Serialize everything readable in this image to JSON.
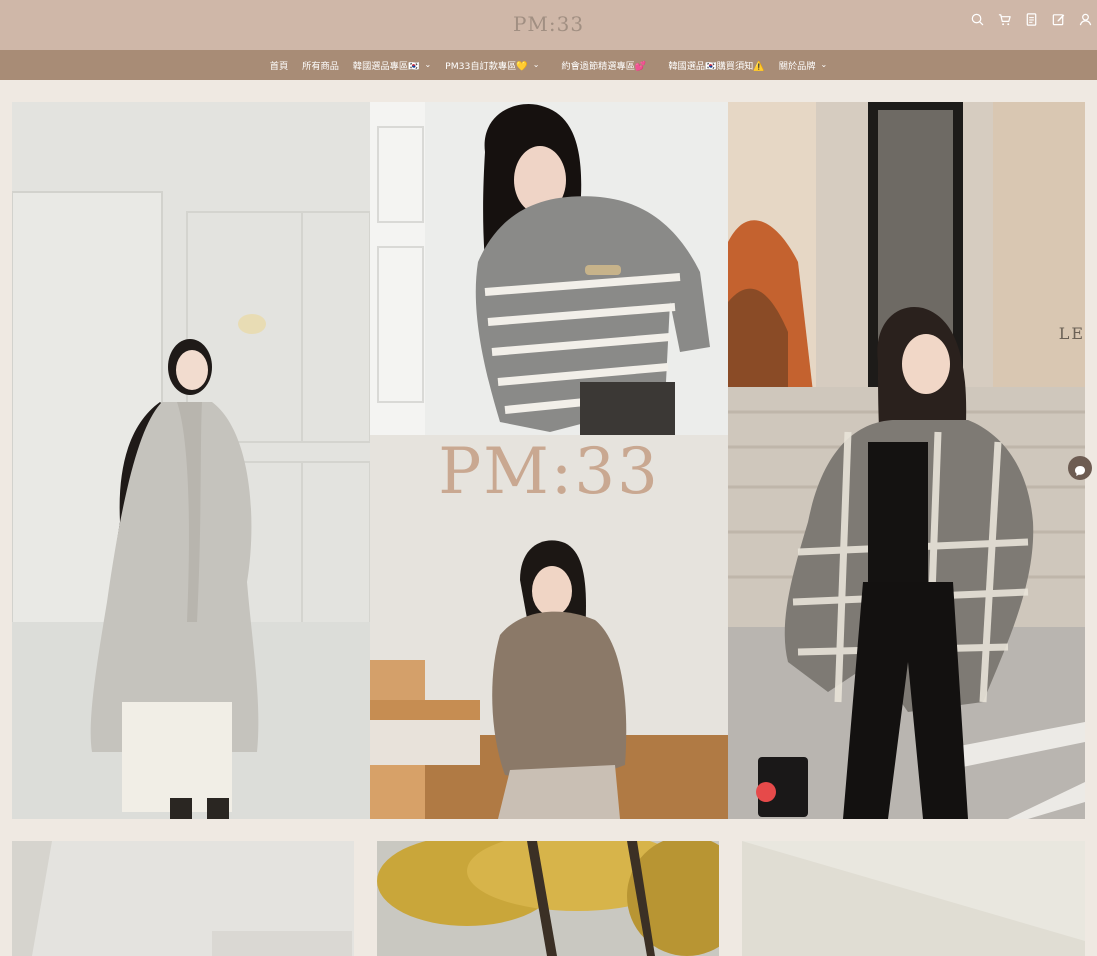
{
  "header": {
    "logo": "PM:33",
    "icons": [
      "search-icon",
      "cart-icon",
      "orders-icon",
      "edit-icon",
      "user-icon"
    ]
  },
  "nav": {
    "items": [
      {
        "label": "首頁",
        "has_dropdown": false
      },
      {
        "label": "所有商品",
        "has_dropdown": false
      },
      {
        "label": "韓國選品專區🇰🇷",
        "has_dropdown": true
      },
      {
        "label": "PM33自訂款專區💛",
        "has_dropdown": true
      },
      {
        "label": "約會過節精選專區💕",
        "has_dropdown": false
      },
      {
        "label": "韓國選品🇰🇷購買須知⚠️",
        "has_dropdown": false
      },
      {
        "label": "關於品牌",
        "has_dropdown": true
      }
    ]
  },
  "hero": {
    "overlay_logo": "PM:33",
    "storefront_text": "LE"
  },
  "colors": {
    "topbar": "#cfb7a8",
    "navbar": "#a88c76",
    "page_bg": "#efe9e2",
    "logo": "#a18f82"
  }
}
